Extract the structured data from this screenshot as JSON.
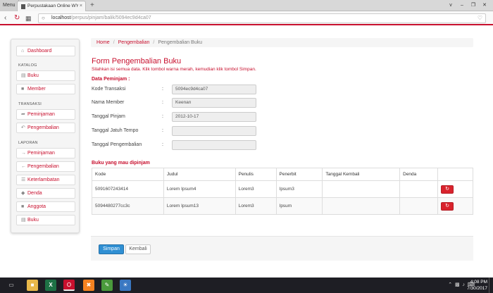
{
  "browser": {
    "menu_label": "Menu",
    "tab_title": "Perpustakaan Online WYA",
    "tab_close": "×",
    "new_tab": "+",
    "window_buttons": [
      "v",
      "–",
      "❐",
      "✕"
    ],
    "url_host": "localhost",
    "url_path": "/perpus/pinjam/balik/5094ec9d4ca07"
  },
  "sidebar": {
    "dashboard": "Dashboard",
    "katalog_heading": "KATALOG",
    "katalog": [
      "Buku",
      "Member"
    ],
    "transaksi_heading": "TRANSAKSI",
    "transaksi": [
      "Peminjaman",
      "Pengembalian"
    ],
    "laporan_heading": "LAPORAN",
    "laporan": [
      "Peminjaman",
      "Pengembalian",
      "Keterlambatan",
      "Denda",
      "Anggota",
      "Buku"
    ]
  },
  "breadcrumb": {
    "home": "Home",
    "section": "Pengembalian",
    "current": "Pengembalian Buku",
    "separator": "/"
  },
  "form": {
    "title": "Form Pengembalian Buku",
    "subtitle": "Silahkan isi semua data. Klik tombol warna merah, kemudian klik tombol Simpan.",
    "section_peminjam": "Data Peminjam :",
    "colon": ":",
    "fields": [
      {
        "label": "Kode Transaksi",
        "value": "5094ec9d4ca07"
      },
      {
        "label": "Nama Member",
        "value": "Keenan"
      },
      {
        "label": "Tanggal Pinjam",
        "value": "2012-10-17"
      },
      {
        "label": "Tanggal Jatuh Tempo",
        "value": ""
      },
      {
        "label": "Tanggal Pengembalian",
        "value": ""
      }
    ],
    "section_books": "Buku yang mau dipinjam"
  },
  "table": {
    "headers": [
      "Kode",
      "Judul",
      "Penulis",
      "Penerbit",
      "Tanggal Kembali",
      "Denda",
      ""
    ],
    "rows": [
      [
        "5091607243414",
        "Lorem Ipsum4",
        "Lorem3",
        "Ipsum3",
        "",
        ""
      ],
      [
        "5094480277cc3c",
        "Lorem Ipsum13",
        "Lorem3",
        "Ipsum",
        "",
        ""
      ]
    ]
  },
  "actions": {
    "simpan": "Simpan",
    "kembali": "Kembali"
  },
  "taskbar": {
    "time": "4:08 PM",
    "date": "7/30/2017"
  },
  "colors": {
    "accent": "#c8102e",
    "primary_button": "#2f8fd3",
    "danger_button": "#d9232d"
  }
}
